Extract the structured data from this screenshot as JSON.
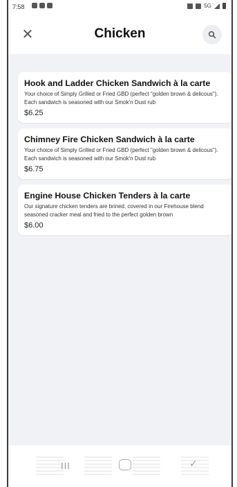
{
  "status_bar": {
    "time": "7:58",
    "right_text": "5G"
  },
  "header": {
    "title": "Chicken"
  },
  "menu_items": [
    {
      "name": "Hook and Ladder Chicken Sandwich à la carte",
      "description": "Your choice of Simply Grilled or Fried GBD (perfect \"golden brown & delicous\"). Each sandwich is seasoned with our Smok'n Dust rub",
      "price": "$6.25"
    },
    {
      "name": "Chimney Fire Chicken Sandwich à la carte",
      "description": "Your choice of Simply Grilled or Fried GBD (perfect \"golden brown & delicous\"). Each sandwich is seasoned with our Smok'n Dust rub",
      "price": "$6.75"
    },
    {
      "name": "Engine House Chicken Tenders à la carte",
      "description": "Our signature chicken tenders are brined, covered in our Firehouse blend seasoned cracker meal and fried to the perfect golden brown",
      "price": "$6.00"
    }
  ],
  "nav": {
    "recents_label": "III"
  },
  "icons": {
    "close": "close-icon",
    "search": "search-icon",
    "home": "home-icon",
    "back": "back-icon"
  }
}
